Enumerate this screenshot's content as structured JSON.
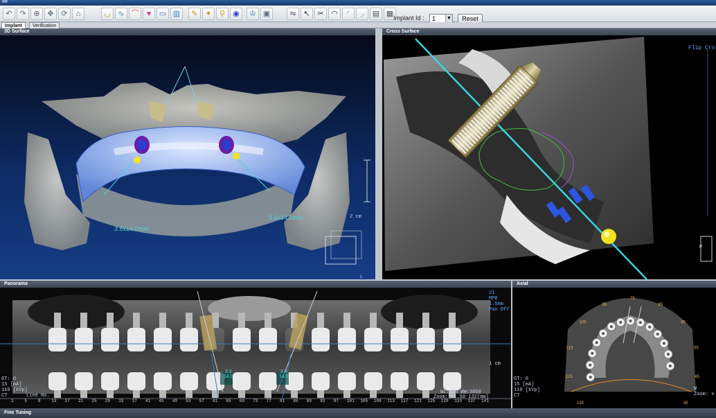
{
  "window": {
    "title": "ile"
  },
  "toolbar": {
    "icons": [
      "undo-icon",
      "redo-icon",
      "zoom-in-icon",
      "pan-icon",
      "rotate-icon",
      "reset-view-icon",
      "jaw-icon",
      "nerve-icon",
      "arch-icon",
      "tooth-icon",
      "measure-icon",
      "bone-icon",
      "implant-icon",
      "abutment-icon",
      "screw-icon",
      "sleeve-icon",
      "crown-icon",
      "guide-icon",
      "mirror-icon",
      "pointer-icon",
      "pliers-icon",
      "denture-icon",
      "upper-jaw-icon",
      "lower-jaw-icon",
      "layout-icon",
      "layout-split-icon"
    ],
    "implant_id_label": "Implant Id :",
    "implant_id_value": "1",
    "reset_label": "Reset"
  },
  "tabs": [
    {
      "label": "Implant",
      "active": true
    },
    {
      "label": "Verification",
      "active": false
    }
  ],
  "panels": {
    "surface": {
      "title": "3D Surface",
      "measure_left": "3.6x14.0mm",
      "measure_right": "3.4x14.0mm",
      "scale_label": "2 cm",
      "orient_label": "L"
    },
    "cross": {
      "title": "Cross Surface",
      "corner_label": "Flip Cro",
      "orient_label": "P"
    },
    "panorama": {
      "title": "Panorama",
      "left_info": [
        "GT: 0",
        "15 [mA]",
        "110 [kVp]",
        "CT"
      ],
      "right_info": [
        "21",
        "MPR",
        "1.5mm",
        "Pan Off"
      ],
      "ticks": [
        "1",
        "5",
        "9",
        "13",
        "17",
        "21",
        "25",
        "29",
        "33",
        "37",
        "41",
        "45",
        "49",
        "53",
        "57",
        "61",
        "65",
        "69",
        "73",
        "77",
        "81",
        "85",
        "89",
        "93",
        "97",
        "101",
        "105",
        "109",
        "113",
        "117",
        "121",
        "125",
        "129",
        "133",
        "137",
        "141"
      ],
      "implant_left_label": [
        "3.3",
        "14.0"
      ],
      "implant_right_label": [
        "3.8",
        "14.0"
      ],
      "zoom_label": "WL:525 WW:3050",
      "zoom_value": "Zoom: x1.50 132[mm]",
      "scale_label": "1 cm",
      "line_label": "Line No."
    },
    "axial": {
      "title": "Axial",
      "left_info": [
        "GT: 0",
        "15 [mA]",
        "110 [kVp]",
        "CT"
      ],
      "right_info": [
        "W",
        "Zoom: x"
      ],
      "arch_numbers": [
        "75",
        "85",
        "65",
        "95",
        "105",
        "55",
        "115",
        "45",
        "125",
        "35",
        "135",
        "25",
        "145"
      ]
    }
  },
  "statusbar": {
    "label": "Fine Tuning"
  },
  "colors": {
    "accent_cyan": "#4dd3d6",
    "implant_gold": "#b8a060",
    "marker_yellow": "#f2e31c",
    "nerve_blue": "#2d55e0",
    "surface_blue": "#9fbfff"
  }
}
